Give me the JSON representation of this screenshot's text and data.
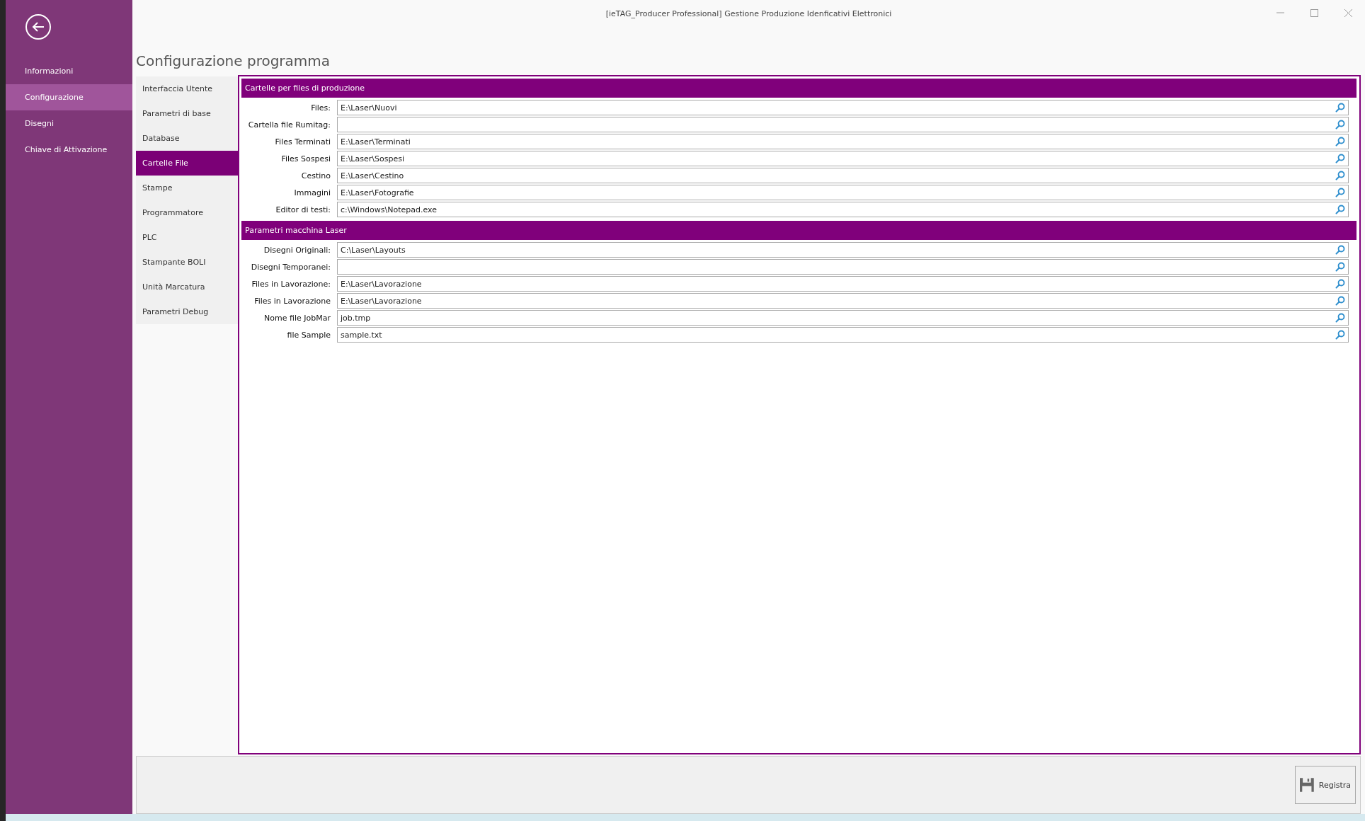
{
  "window": {
    "title": "[ieTAG_Producer Professional] Gestione Produzione Idenficativi Elettronici"
  },
  "sidebar": {
    "items": [
      {
        "label": "Informazioni",
        "selected": false
      },
      {
        "label": "Configurazione",
        "selected": true
      },
      {
        "label": "Disegni",
        "selected": false
      },
      {
        "label": "Chiave di Attivazione",
        "selected": false
      }
    ]
  },
  "page_title": "Configurazione programma",
  "tabs": [
    {
      "label": "Interfaccia Utente",
      "selected": false
    },
    {
      "label": "Parametri di base",
      "selected": false
    },
    {
      "label": "Database",
      "selected": false
    },
    {
      "label": "Cartelle File",
      "selected": true
    },
    {
      "label": "Stampe",
      "selected": false
    },
    {
      "label": "Programmatore",
      "selected": false
    },
    {
      "label": "PLC",
      "selected": false
    },
    {
      "label": "Stampante BOLI",
      "selected": false
    },
    {
      "label": "Unità Marcatura",
      "selected": false
    },
    {
      "label": "Parametri Debug",
      "selected": false
    }
  ],
  "sections": [
    {
      "title": "Cartelle per files di produzione",
      "fields": [
        {
          "label": "Files:",
          "value": "E:\\Laser\\Nuovi"
        },
        {
          "label": "Cartella file Rumitag:"
        },
        {
          "label": "Files Terminati",
          "value": "E:\\Laser\\Terminati"
        },
        {
          "label": "Files Sospesi",
          "value": "E:\\Laser\\Sospesi"
        },
        {
          "label": "Cestino",
          "value": "E:\\Laser\\Cestino"
        },
        {
          "label": "Immagini",
          "value": "E:\\Laser\\Fotografie"
        },
        {
          "label": "Editor di testi:",
          "value": "c:\\Windows\\Notepad.exe"
        }
      ]
    },
    {
      "title": "Parametri macchina Laser",
      "fields": [
        {
          "label": "Disegni Originali:",
          "value": "C:\\Laser\\Layouts"
        },
        {
          "label": "Disegni Temporanei:"
        },
        {
          "label": "Files in Lavorazione:",
          "value": "E:\\Laser\\Lavorazione"
        },
        {
          "label": "Files in Lavorazione",
          "value": "E:\\Laser\\Lavorazione"
        },
        {
          "label": "Nome file JobMar",
          "value": "job.tmp"
        },
        {
          "label": "file Sample",
          "value": "sample.txt"
        }
      ]
    }
  ],
  "save_button": {
    "label": "Registra"
  }
}
